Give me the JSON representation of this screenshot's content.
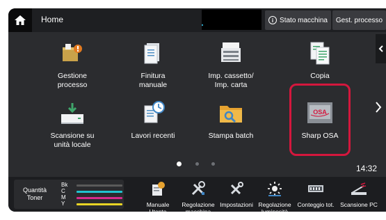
{
  "header": {
    "title": "Home",
    "status_button": "Stato macchina",
    "job_button": "Gest. processo"
  },
  "tiles": [
    {
      "label": "Gestione\nprocesso",
      "icon": "document-box-icon"
    },
    {
      "label": "Finitura\nmanuale",
      "icon": "manual-finish-icon"
    },
    {
      "label": "Imp. cassetto/\nImp. carta",
      "icon": "tray-settings-icon"
    },
    {
      "label": "Copia",
      "icon": "copy-icon"
    },
    {
      "label": "Scansione su\nunità locale",
      "icon": "scan-local-icon"
    },
    {
      "label": "Lavori recenti",
      "icon": "recent-jobs-icon"
    },
    {
      "label": "Stampa batch",
      "icon": "batch-print-icon"
    },
    {
      "label": "Sharp OSA",
      "icon": "sharp-osa-icon"
    }
  ],
  "sharp_osa_logo_text": "OSA",
  "clock": "14:32",
  "pager": {
    "pages": 3,
    "current": 1
  },
  "toner": {
    "title": "Quantità\nToner",
    "levels": [
      {
        "name": "Bk",
        "color": "#2b2b2b"
      },
      {
        "name": "C",
        "color": "#20c3cf"
      },
      {
        "name": "M",
        "color": "#d62b8c"
      },
      {
        "name": "Y",
        "color": "#e8d425"
      }
    ]
  },
  "tools": [
    {
      "label": "Manuale\nUtente",
      "icon": "user-manual-icon"
    },
    {
      "label": "Regolazione\nmacchina",
      "icon": "machine-adjust-icon"
    },
    {
      "label": "Impostazioni",
      "icon": "settings-tools-icon"
    },
    {
      "label": "Regolazione\nluminosità",
      "icon": "brightness-icon"
    },
    {
      "label": "Conteggio tot.",
      "icon": "counter-icon"
    },
    {
      "label": "Scansione PC",
      "icon": "scan-pc-icon"
    }
  ],
  "colors": {
    "panel": "#2b2c2f",
    "highlight": "#d4173d",
    "bottombar": "#1c1d20"
  }
}
